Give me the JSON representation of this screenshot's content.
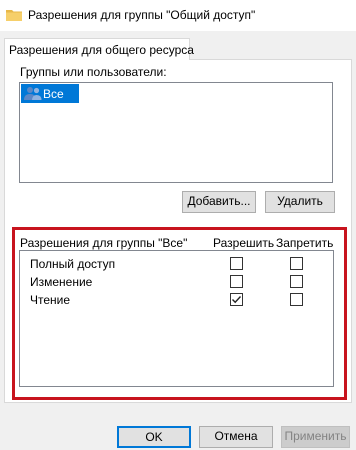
{
  "window": {
    "title": "Разрешения для группы \"Общий доступ\""
  },
  "tabs": [
    {
      "label": "Разрешения для общего ресурса"
    }
  ],
  "groups": {
    "label": "Группы или пользователи:",
    "items": [
      {
        "name": "Все",
        "selected": true
      }
    ]
  },
  "buttons": {
    "add": "Добавить...",
    "remove": "Удалить"
  },
  "permissions": {
    "header": "Разрешения для группы \"Все\"",
    "allow_header": "Разрешить",
    "deny_header": "Запретить",
    "rows": [
      {
        "label": "Полный доступ",
        "allow": false,
        "deny": false
      },
      {
        "label": "Изменение",
        "allow": false,
        "deny": false
      },
      {
        "label": "Чтение",
        "allow": true,
        "deny": false
      }
    ]
  },
  "footer": {
    "ok": "OK",
    "cancel": "Отмена",
    "apply": "Применить"
  },
  "colors": {
    "accent": "#0078d7",
    "highlight_frame": "#c8141e"
  }
}
